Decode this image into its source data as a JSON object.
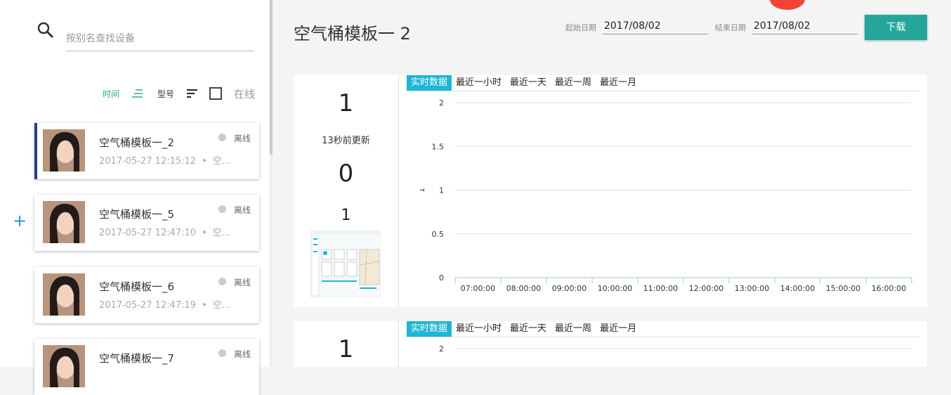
{
  "sidebar": {
    "search": {
      "placeholder": "按别名查找设备"
    },
    "sort": {
      "time_label": "时间",
      "type_label": "型号",
      "online_label": "在线"
    },
    "devices": [
      {
        "name": "空气桶模板一_2",
        "time": "2017-05-27 12:15:12",
        "template": "空...",
        "status": "离线"
      },
      {
        "name": "空气桶模板一_5",
        "time": "2017-05-27 12:47:10",
        "template": "空...",
        "status": "离线"
      },
      {
        "name": "空气桶模板一_6",
        "time": "2017-05-27 12:47:19",
        "template": "空...",
        "status": "离线"
      },
      {
        "name": "空气桶模板一_7",
        "time": "",
        "template": "",
        "status": "离线"
      }
    ]
  },
  "header": {
    "title": "空气桶模板一 2",
    "start_label": "起始日期",
    "start_date": "2017/08/02",
    "end_label": "结束日期",
    "end_date": "2017/08/02",
    "download_label": "下载"
  },
  "panels": [
    {
      "value1": "1",
      "updated": "13秒前更新",
      "value2": "0",
      "value3": "1",
      "tabs": [
        "实时数据",
        "最近一小时",
        "最近一天",
        "最近一周",
        "最近一月"
      ]
    },
    {
      "value1": "1",
      "tabs": [
        "实时数据",
        "最近一小时",
        "最近一天",
        "最近一周",
        "最近一月"
      ]
    }
  ],
  "chart_data": [
    {
      "type": "line",
      "ylabel": "1",
      "y_ticks": [
        "2",
        "1.5",
        "1",
        "0.5",
        "0"
      ],
      "ylim": [
        0,
        2
      ],
      "x": [
        "07:00:00",
        "08:00:00",
        "09:00:00",
        "10:00:00",
        "11:00:00",
        "12:00:00",
        "13:00:00",
        "14:00:00",
        "15:00:00",
        "16:00:00"
      ],
      "series": [],
      "grid": true
    },
    {
      "type": "line",
      "y_ticks": [
        "2"
      ],
      "ylim": [
        0,
        2
      ],
      "x": [],
      "series": [],
      "grid": true
    }
  ],
  "colors": {
    "accent": "#26a69a",
    "tab_active": "#1fb5d4",
    "selected_border": "#1e3f8c",
    "add_icon": "#1a9bdc"
  }
}
